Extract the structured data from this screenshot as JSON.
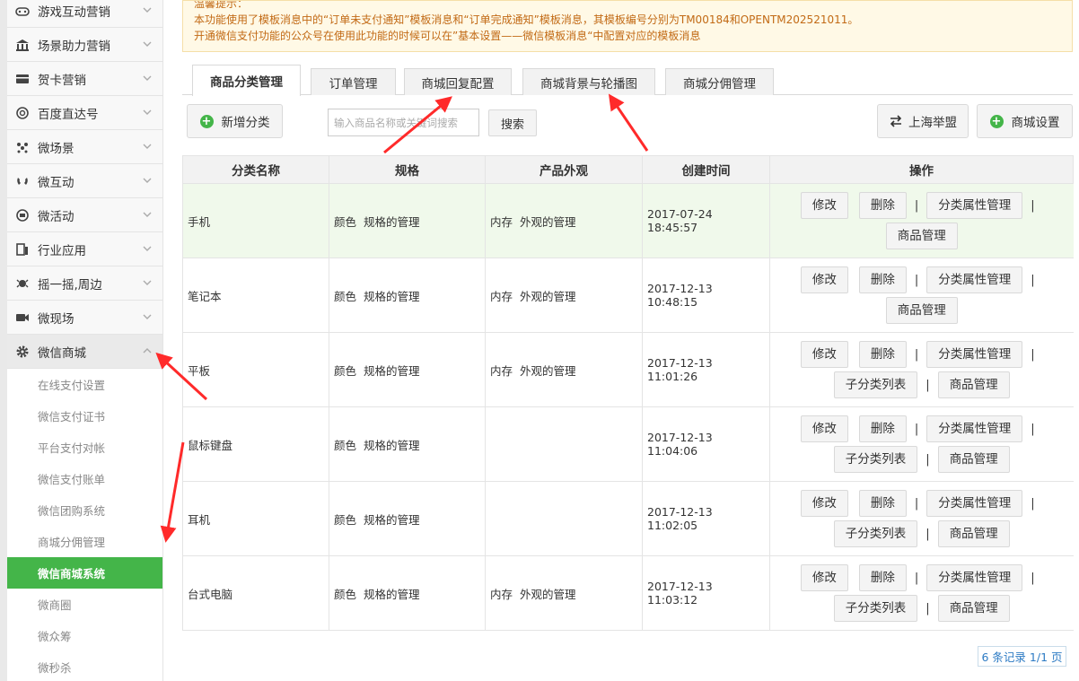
{
  "sidebar": {
    "items": [
      {
        "label": "游戏互动营销",
        "icon": "gamepad-icon"
      },
      {
        "label": "场景助力营销",
        "icon": "bank-icon"
      },
      {
        "label": "贺卡营销",
        "icon": "card-icon"
      },
      {
        "label": "百度直达号",
        "icon": "baidu-icon"
      },
      {
        "label": "微场景",
        "icon": "scene-icon"
      },
      {
        "label": "微互动",
        "icon": "interact-icon"
      },
      {
        "label": "微活动",
        "icon": "activity-icon"
      },
      {
        "label": "行业应用",
        "icon": "industry-icon"
      },
      {
        "label": "摇一摇,周边",
        "icon": "shake-icon"
      },
      {
        "label": "微现场",
        "icon": "video-icon"
      },
      {
        "label": "微信商城",
        "icon": "gear-icon"
      }
    ],
    "subitems": [
      {
        "label": "在线支付设置"
      },
      {
        "label": "微信支付证书"
      },
      {
        "label": "平台支付对帐"
      },
      {
        "label": "微信支付账单"
      },
      {
        "label": "微信团购系统"
      },
      {
        "label": "商城分佣管理"
      },
      {
        "label": "微信商城系统"
      },
      {
        "label": "微商圈"
      },
      {
        "label": "微众筹"
      },
      {
        "label": "微秒杀"
      }
    ]
  },
  "notice": {
    "line0": "温馨提示：",
    "line1": "本功能使用了模板消息中的“订单未支付通知”模板消息和“订单完成通知”模板消息，其模板编号分别为TM00184和OPENTM202521011。",
    "line2": "开通微信支付功能的公众号在使用此功能的时候可以在”基本设置——微信模板消息“中配置对应的模板消息"
  },
  "tabs": [
    {
      "label": "商品分类管理"
    },
    {
      "label": "订单管理"
    },
    {
      "label": "商城回复配置"
    },
    {
      "label": "商城背景与轮播图"
    },
    {
      "label": "商城分佣管理"
    }
  ],
  "toolbar": {
    "add_label": "新增分类",
    "search_placeholder": "输入商品名称或关键词搜索",
    "search_label": "搜索",
    "shanghai_label": "上海举盟",
    "settings_label": "商城设置"
  },
  "table": {
    "headers": [
      "分类名称",
      "规格",
      "产品外观",
      "创建时间",
      "操作"
    ],
    "rows": [
      {
        "name": "手机",
        "spec": "颜色  规格的管理",
        "appearance": "内存  外观的管理",
        "time": "2017-07-24 18:45:57"
      },
      {
        "name": "笔记本",
        "spec": "颜色  规格的管理",
        "appearance": "内存  外观的管理",
        "time": "2017-12-13 10:48:15"
      },
      {
        "name": "平板",
        "spec": "颜色  规格的管理",
        "appearance": "内存  外观的管理",
        "time": "2017-12-13 11:01:26"
      },
      {
        "name": "鼠标键盘",
        "spec": "颜色  规格的管理",
        "appearance": "",
        "time": "2017-12-13 11:04:06"
      },
      {
        "name": "耳机",
        "spec": "颜色  规格的管理",
        "appearance": "",
        "time": "2017-12-13 11:02:05"
      },
      {
        "name": "台式电脑",
        "spec": "颜色  规格的管理",
        "appearance": "内存  外观的管理",
        "time": "2017-12-13 11:03:12"
      }
    ],
    "ops": {
      "edit": "修改",
      "delete": "删除",
      "attr": "分类属性管理",
      "sub": "子分类列表",
      "goods": "商品管理",
      "sep": "|"
    }
  },
  "pager": {
    "text": "6 条记录 1/1 页"
  },
  "colors": {
    "accent_green": "#44b549",
    "notice_text": "#c26a15",
    "arrow_red": "#ff2a2a"
  }
}
